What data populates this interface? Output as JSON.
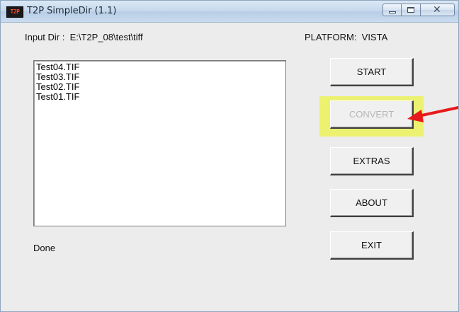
{
  "window": {
    "icon_text": "T2P",
    "title": "T2P SimpleDir (1.1)",
    "controls": {
      "minimize_icon": "minimize-icon",
      "maximize_icon": "maximize-icon",
      "close_icon": "close-icon",
      "close_glyph": "✕"
    }
  },
  "header": {
    "input_dir": "Input Dir :  E:\\T2P_08\\test\\tiff",
    "platform": "PLATFORM:  VISTA"
  },
  "file_list": {
    "items": [
      "Test04.TIF",
      "Test03.TIF",
      "Test02.TIF",
      "Test01.TIF"
    ]
  },
  "buttons": {
    "start": "START",
    "convert": "CONVERT",
    "extras": "EXTRAS",
    "about": "ABOUT",
    "exit": "EXIT"
  },
  "status": "Done",
  "annotation": {
    "highlight_color": "#ecf446",
    "arrow_color": "#e8191b"
  }
}
